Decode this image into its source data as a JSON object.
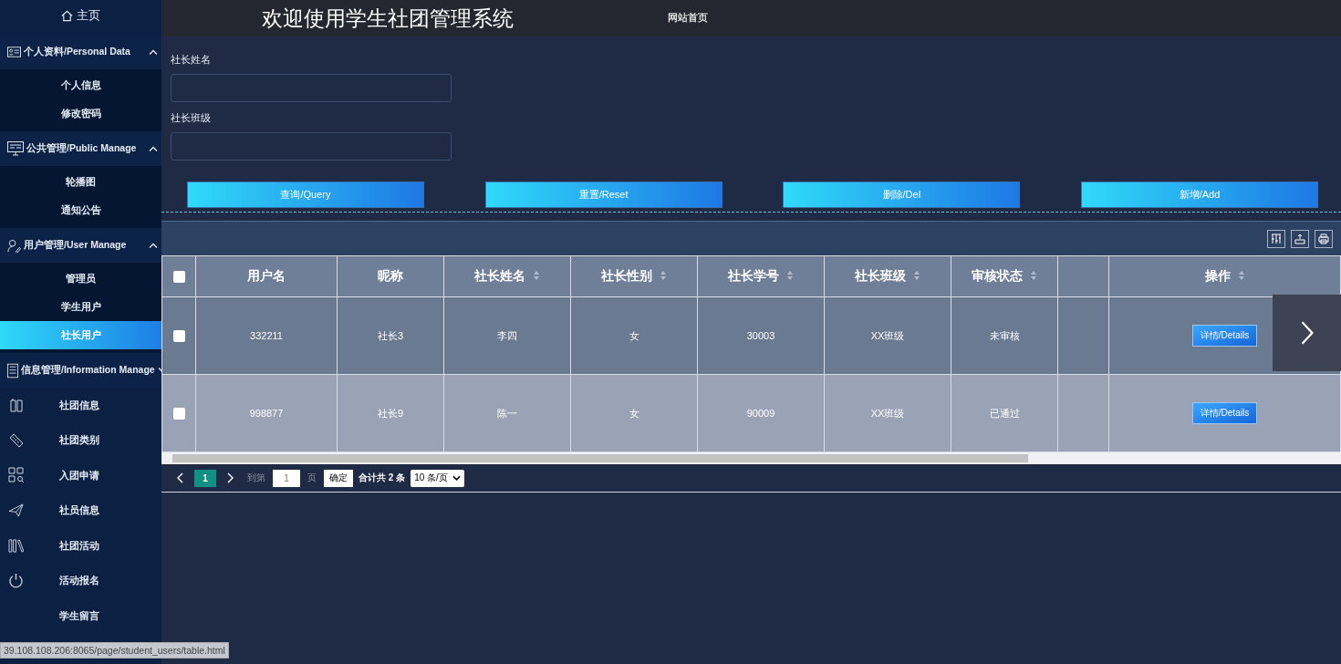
{
  "sidebar": {
    "home": "主页",
    "groups": [
      {
        "title": "个人资料/Personal Data",
        "expanded": true,
        "items": [
          {
            "label": "个人信息",
            "selected": false
          },
          {
            "label": "修改密码",
            "selected": false
          }
        ]
      },
      {
        "title": "公共管理/Public Manage",
        "expanded": true,
        "items": [
          {
            "label": "轮播图",
            "selected": false
          },
          {
            "label": "通知公告",
            "selected": false
          }
        ]
      },
      {
        "title": "用户管理/User Manage",
        "expanded": true,
        "items": [
          {
            "label": "管理员",
            "selected": false
          },
          {
            "label": "学生用户",
            "selected": false
          },
          {
            "label": "社长用户",
            "selected": true
          }
        ]
      },
      {
        "title": "信息管理/Information Manage",
        "expanded": false,
        "items": [
          {
            "label": "社团信息",
            "selected": false
          },
          {
            "label": "社团类别",
            "selected": false
          },
          {
            "label": "入团申请",
            "selected": false
          },
          {
            "label": "社员信息",
            "selected": false
          },
          {
            "label": "社团活动",
            "selected": false
          },
          {
            "label": "活动报名",
            "selected": false
          },
          {
            "label": "学生留言",
            "selected": false
          }
        ]
      }
    ]
  },
  "header": {
    "title": "欢迎使用学生社团管理系统",
    "link": "网站首页"
  },
  "search": {
    "fields": [
      {
        "label": "社长姓名"
      },
      {
        "label": "社长班级"
      }
    ],
    "buttons": [
      "查询/Query",
      "重置/Reset",
      "删除/Del",
      "新增/Add"
    ]
  },
  "table": {
    "select_all_checked": false,
    "columns": [
      {
        "label": "用户名",
        "sortable": false
      },
      {
        "label": "昵称",
        "sortable": false
      },
      {
        "label": "社长姓名",
        "sortable": true
      },
      {
        "label": "社长性别",
        "sortable": true
      },
      {
        "label": "社长学号",
        "sortable": true
      },
      {
        "label": "社长班级",
        "sortable": true
      },
      {
        "label": "审核状态",
        "sortable": true
      },
      {
        "sortable": false
      },
      {
        "label": "操作",
        "sortable": true
      }
    ],
    "rows": [
      {
        "checked": false,
        "cells": [
          "332211",
          "社长3",
          "李四",
          "女",
          "30003",
          "XX班级",
          "未审核"
        ],
        "action": "详情/Details"
      },
      {
        "checked": false,
        "cells": [
          "998877",
          "社长9",
          "陈一",
          "女",
          "90009",
          "XX班级",
          "已通过"
        ],
        "action": "详情/Details"
      }
    ]
  },
  "pagination": {
    "pages": [
      {
        "label": "1",
        "selected": true
      }
    ],
    "goto_label": "到第",
    "page_value": "1",
    "page_unit": "页",
    "confirm": "确定",
    "total": "合计共 2 条",
    "page_size": "10 条/页"
  },
  "status_url": "39.108.108.206:8065/page/student_users/table.html"
}
